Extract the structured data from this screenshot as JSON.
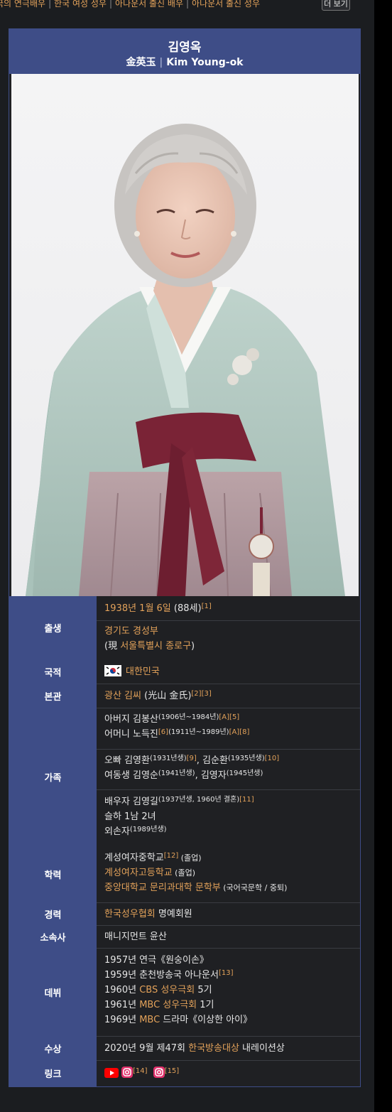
{
  "topbar": {
    "cat1": "국의 연극배우",
    "cat2": "한국 여성 성우",
    "cat3": "아나운서 출신 배우",
    "cat4": "아나운서 출신 성우",
    "more": "더 보기"
  },
  "header": {
    "name": "김영옥",
    "hanja": "金英玉",
    "english": "Kim Young-ok"
  },
  "rows": {
    "birth": {
      "label": "출생",
      "date": "1938년 1월 6일",
      "age": "(88세)",
      "ref": "[1]",
      "place": "경기도 경성부",
      "now_prefix": "(現 ",
      "now_place": "서울특별시 종로구",
      "now_suffix": ")"
    },
    "nationality": {
      "label": "국적",
      "value": "대한민국"
    },
    "clan": {
      "label": "본관",
      "link": "광산 김씨",
      "paren": " (光山 金氏)",
      "ref1": "[2]",
      "ref2": "[3]"
    },
    "family": {
      "label": "가족",
      "father_prefix": "아버지 ",
      "father": "김봉산",
      "father_years": "(1906년~1984년)",
      "father_ref1": "[A]",
      "father_ref2": "[5]",
      "mother_prefix": "어머니 ",
      "mother": "노득진",
      "mother_ref": "[6]",
      "mother_years": "(1911년~1989년)",
      "mother_ref1": "[A]",
      "mother_ref2": "[8]",
      "brother_prefix": "오빠 ",
      "brother1": "김영환",
      "brother1_years": "(1931년생)",
      "brother1_ref": "[9]",
      "brother_sep": ", ",
      "brother2": "김순환",
      "brother2_years": "(1935년생)",
      "brother2_ref": "[10]",
      "sister_prefix": "여동생 ",
      "sister1": "김영순",
      "sister1_years": "(1941년생)",
      "sister_sep": ", ",
      "sister2": "김영자",
      "sister2_years": "(1945년생)",
      "spouse_prefix": "배우자 ",
      "spouse": "김영길",
      "spouse_years": "(1937년생, 1960년 결혼)",
      "spouse_ref": "[11]",
      "children": "슬하 1남 2녀",
      "grandson": "외손자",
      "grandson_years": "(1989년생)"
    },
    "education": {
      "label": "학력",
      "school1": "계성여자중학교",
      "school1_ref": "[12]",
      "school1_note": " (졸업)",
      "school2": "계성여자고등학교",
      "school2_note": " (졸업)",
      "school3": "중앙대학교 문리과대학 문학부",
      "school3_note": " (국어국문학 / 중퇴)"
    },
    "career": {
      "label": "경력",
      "link": "한국성우협회",
      "rest": " 명예회원"
    },
    "agency": {
      "label": "소속사",
      "value": "매니지먼트 윤산"
    },
    "debut": {
      "label": "데뷔",
      "l1": "1957년 연극《원숭이손》",
      "l2": "1959년 춘천방송국 아나운서",
      "l2_ref": "[13]",
      "l3_prefix": "1960년 ",
      "l3_link": "CBS 성우극회",
      "l3_suffix": " 5기",
      "l4_prefix": "1961년 ",
      "l4_link": "MBC 성우극회",
      "l4_suffix": " 1기",
      "l5_prefix": "1969년 ",
      "l5_link": "MBC",
      "l5_suffix": " 드라마《이상한 아이》"
    },
    "award": {
      "label": "수상",
      "prefix": "2020년 9월 제47회 ",
      "link": "한국방송대상",
      "suffix": " 내레이션상"
    },
    "links": {
      "label": "링크",
      "ref1": "[14]",
      "ref2": "[15]"
    }
  },
  "colors": {
    "header_bg": "#3e4d87",
    "link": "#e3a25a",
    "background": "#1b1d20"
  },
  "icons": [
    "youtube-icon",
    "instagram-icon",
    "flag-korea-icon"
  ]
}
